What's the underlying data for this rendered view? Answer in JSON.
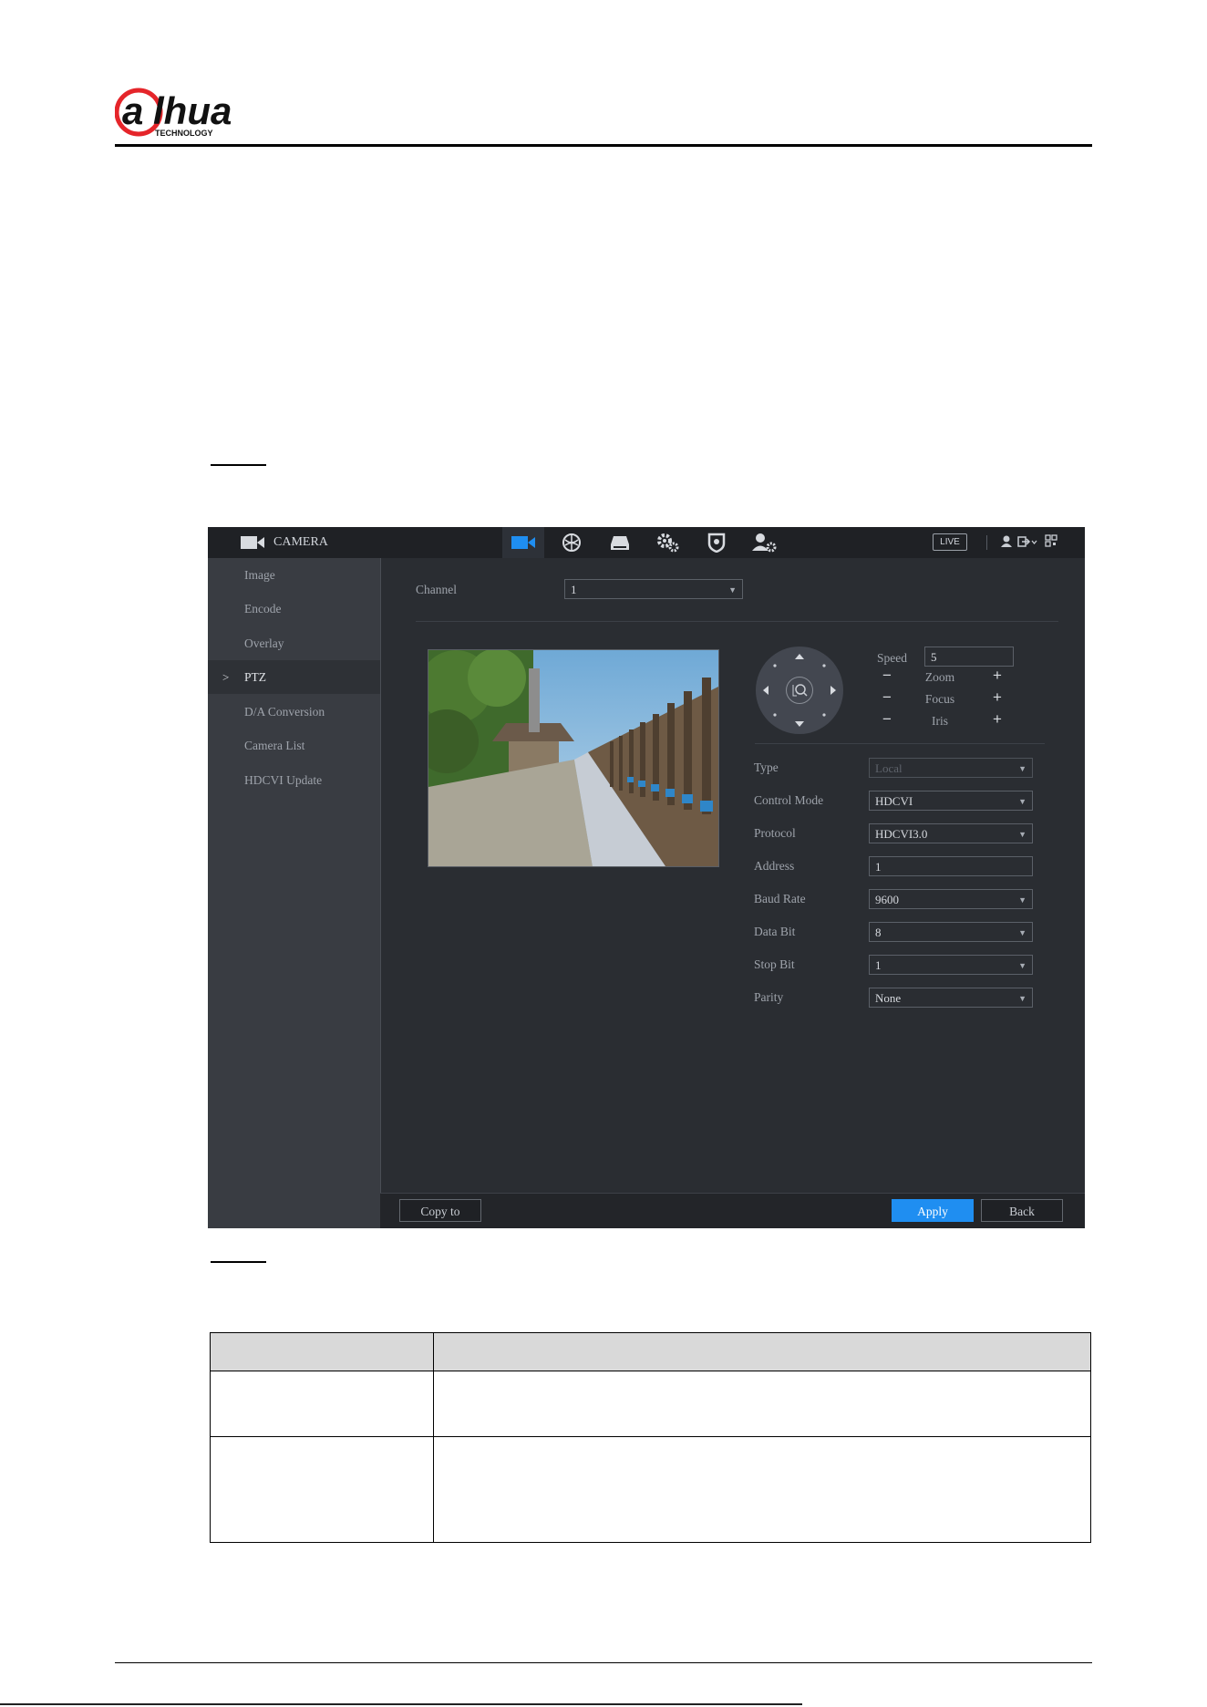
{
  "brand": {
    "logo_text": "alhua",
    "tagline": "TECHNOLOGY",
    "logo_red": "#e5252a"
  },
  "app": {
    "title": "CAMERA",
    "live_label": "LIVE",
    "nav_icons": [
      "camera-icon",
      "network-icon",
      "storage-icon",
      "system-settings-icon",
      "security-icon",
      "account-icon"
    ],
    "sidebar": {
      "items": [
        {
          "label": "Image"
        },
        {
          "label": "Encode"
        },
        {
          "label": "Overlay"
        },
        {
          "label": "PTZ",
          "active": true
        },
        {
          "label": "D/A Conversion"
        },
        {
          "label": "Camera List"
        },
        {
          "label": "HDCVI Update"
        }
      ]
    },
    "channel": {
      "label": "Channel",
      "value": "1"
    },
    "ptz_controls": {
      "speed_label": "Speed",
      "speed_value": "5",
      "zoom_label": "Zoom",
      "focus_label": "Focus",
      "iris_label": "Iris",
      "minus": "−",
      "plus": "+"
    },
    "fields": {
      "type": {
        "label": "Type",
        "value": "Local",
        "disabled": true
      },
      "control_mode": {
        "label": "Control Mode",
        "value": "HDCVI"
      },
      "protocol": {
        "label": "Protocol",
        "value": "HDCVI3.0"
      },
      "address": {
        "label": "Address",
        "value": "1"
      },
      "baud_rate": {
        "label": "Baud Rate",
        "value": "9600"
      },
      "data_bit": {
        "label": "Data Bit",
        "value": "8"
      },
      "stop_bit": {
        "label": "Stop Bit",
        "value": "1"
      },
      "parity": {
        "label": "Parity",
        "value": "None"
      }
    },
    "buttons": {
      "copy_to": "Copy to",
      "apply": "Apply",
      "back": "Back"
    },
    "colors": {
      "accent": "#1f8ef1",
      "background": "#2a2d32",
      "sidebar": "#393c42"
    }
  }
}
